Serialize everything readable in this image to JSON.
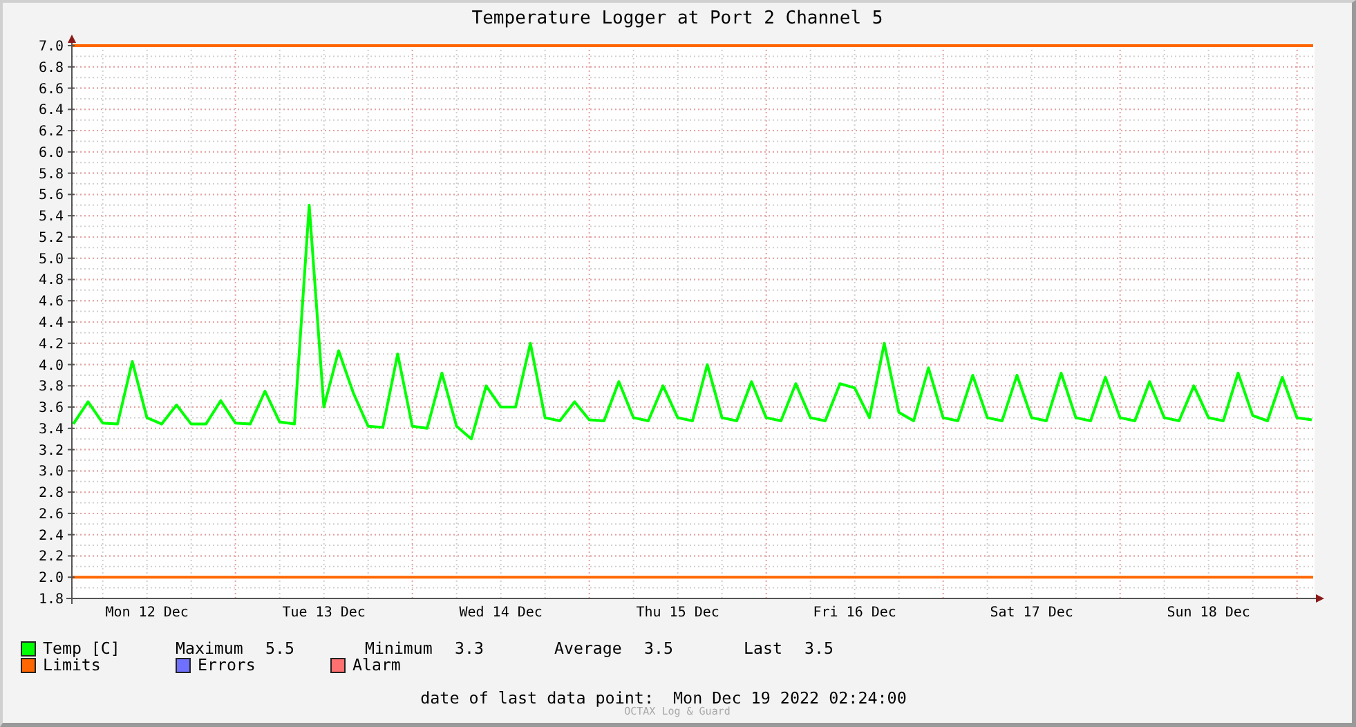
{
  "chart_data": {
    "type": "line",
    "title": "Temperature Logger at Port 2 Channel 5",
    "categories": [
      null,
      null,
      null,
      null,
      null,
      "Mon 12 Dec",
      null,
      null,
      null,
      null,
      null,
      null,
      null,
      null,
      null,
      null,
      null,
      "Tue 13 Dec",
      null,
      null,
      null,
      null,
      null,
      null,
      null,
      null,
      null,
      null,
      null,
      "Wed 14 Dec",
      null,
      null,
      null,
      null,
      null,
      null,
      null,
      null,
      null,
      null,
      null,
      "Thu 15 Dec",
      null,
      null,
      null,
      null,
      null,
      null,
      null,
      null,
      null,
      null,
      null,
      "Fri 16 Dec",
      null,
      null,
      null,
      null,
      null,
      null,
      null,
      null,
      null,
      null,
      null,
      "Sat 17 Dec",
      null,
      null,
      null,
      null,
      null,
      null,
      null,
      null,
      null,
      null,
      null,
      "Sun 18 Dec",
      null,
      null,
      null,
      null,
      null,
      null,
      null
    ],
    "series": [
      {
        "name": "Temp [C]",
        "color": "#00ff00",
        "values": [
          3.44,
          3.65,
          3.45,
          3.44,
          4.03,
          3.5,
          3.44,
          3.62,
          3.44,
          3.44,
          3.66,
          3.45,
          3.44,
          3.75,
          3.46,
          3.44,
          5.5,
          3.6,
          4.13,
          3.73,
          3.42,
          3.41,
          4.1,
          3.42,
          3.4,
          3.92,
          3.42,
          3.3,
          3.8,
          3.6,
          3.6,
          4.2,
          3.5,
          3.47,
          3.65,
          3.48,
          3.47,
          3.84,
          3.5,
          3.47,
          3.8,
          3.5,
          3.47,
          4.0,
          3.5,
          3.47,
          3.84,
          3.5,
          3.47,
          3.82,
          3.5,
          3.47,
          3.82,
          3.78,
          3.5,
          4.2,
          3.55,
          3.47,
          3.97,
          3.5,
          3.47,
          3.9,
          3.5,
          3.47,
          3.9,
          3.5,
          3.47,
          3.92,
          3.5,
          3.47,
          3.88,
          3.5,
          3.47,
          3.84,
          3.5,
          3.47,
          3.8,
          3.5,
          3.47,
          3.92,
          3.52,
          3.47,
          3.88,
          3.5,
          3.48
        ]
      }
    ],
    "ylim": [
      1.8,
      7.0
    ],
    "grid": true,
    "yticks": [
      {
        "value": 1.8,
        "label": "1.8"
      },
      {
        "value": 2.0,
        "label": "2.0"
      },
      {
        "value": 2.2,
        "label": "2.2"
      },
      {
        "value": 2.4,
        "label": "2.4"
      },
      {
        "value": 2.6,
        "label": "2.6"
      },
      {
        "value": 2.8,
        "label": "2.8"
      },
      {
        "value": 3.0,
        "label": "3.0"
      },
      {
        "value": 3.2,
        "label": "3.2"
      },
      {
        "value": 3.4,
        "label": "3.4"
      },
      {
        "value": 3.6,
        "label": "3.6"
      },
      {
        "value": 3.8,
        "label": "3.8"
      },
      {
        "value": 4.0,
        "label": "4.0"
      },
      {
        "value": 4.2,
        "label": "4.2"
      },
      {
        "value": 4.4,
        "label": "4.4"
      },
      {
        "value": 4.6,
        "label": "4.6"
      },
      {
        "value": 4.8,
        "label": "4.8"
      },
      {
        "value": 5.0,
        "label": "5.0"
      },
      {
        "value": 5.2,
        "label": "5.2"
      },
      {
        "value": 5.4,
        "label": "5.4"
      },
      {
        "value": 5.6,
        "label": "5.6"
      },
      {
        "value": 5.8,
        "label": "5.8"
      },
      {
        "value": 6.0,
        "label": "6.0"
      },
      {
        "value": 6.2,
        "label": "6.2"
      },
      {
        "value": 6.4,
        "label": "6.4"
      },
      {
        "value": 6.6,
        "label": "6.6"
      },
      {
        "value": 6.8,
        "label": "6.8"
      },
      {
        "value": 7.0,
        "label": "7.0"
      }
    ],
    "ref_lines": [
      {
        "axis": "y",
        "value": 7.0,
        "color": "#ff6600"
      },
      {
        "axis": "y",
        "value": 2.0,
        "color": "#ff6600"
      }
    ]
  },
  "legend": [
    {
      "label": "Limits",
      "color": "#ff6600"
    },
    {
      "label": "Errors",
      "color": "#7070ff"
    },
    {
      "label": "Alarm",
      "color": "#ff7070"
    }
  ],
  "stats": [
    {
      "label": "Maximum",
      "value": "5.5"
    },
    {
      "label": "Minimum",
      "value": "3.3"
    },
    {
      "label": "Average",
      "value": "3.5"
    },
    {
      "label": "Last",
      "value": "3.5"
    }
  ],
  "last_data_point": {
    "label": "date of last data point:",
    "value": "Mon Dec 19 2022 02:24:00"
  },
  "footer": "OCTAX Log & Guard"
}
